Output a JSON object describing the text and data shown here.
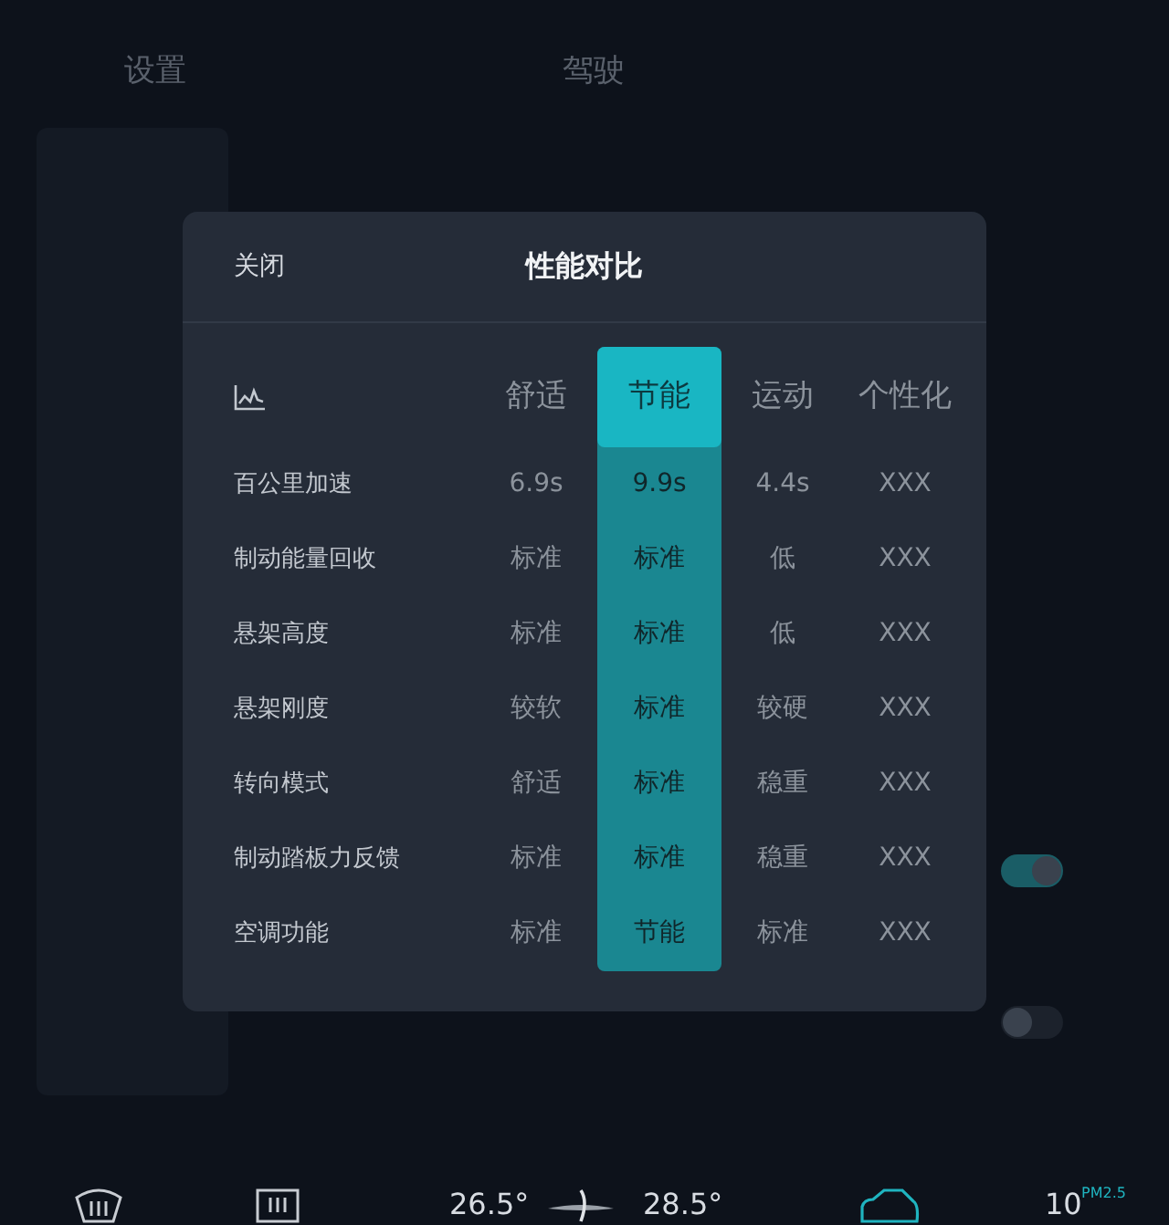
{
  "background": {
    "sidebar_title": "设置",
    "page_title": "驾驶",
    "toggles": [
      {
        "on": true
      },
      {
        "on": false
      }
    ]
  },
  "dialog": {
    "close": "关闭",
    "title": "性能对比",
    "columns": [
      {
        "label": "舒适",
        "selected": false
      },
      {
        "label": "节能",
        "selected": true
      },
      {
        "label": "运动",
        "selected": false
      },
      {
        "label": "个性化",
        "selected": false
      }
    ],
    "rows": [
      {
        "label": "百公里加速",
        "values": [
          "6.9s",
          "9.9s",
          "4.4s",
          "XXX"
        ]
      },
      {
        "label": "制动能量回收",
        "values": [
          "标准",
          "标准",
          "低",
          "XXX"
        ]
      },
      {
        "label": "悬架高度",
        "values": [
          "标准",
          "标准",
          "低",
          "XXX"
        ]
      },
      {
        "label": "悬架刚度",
        "values": [
          "较软",
          "标准",
          "较硬",
          "XXX"
        ]
      },
      {
        "label": "转向模式",
        "values": [
          "舒适",
          "标准",
          "稳重",
          "XXX"
        ]
      },
      {
        "label": "制动踏板力反馈",
        "values": [
          "标准",
          "标准",
          "稳重",
          "XXX"
        ]
      },
      {
        "label": "空调功能",
        "values": [
          "标准",
          "节能",
          "标准",
          "XXX"
        ]
      }
    ]
  },
  "bottom_bar": {
    "temp_left": "26.5°",
    "temp_right": "28.5°",
    "aqi_value": "10",
    "aqi_label": "PM2.5"
  }
}
